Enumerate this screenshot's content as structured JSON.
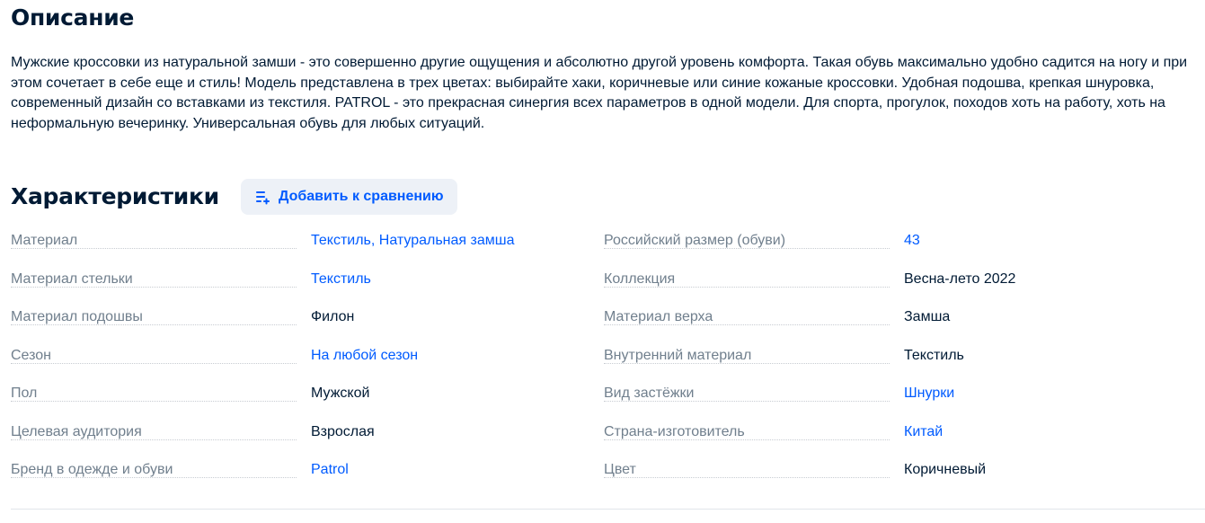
{
  "description": {
    "title": "Описание",
    "text": "Мужские кроссовки из натуральной замши - это совершенно другие ощущения и абсолютно другой уровень комфорта. Такая обувь максимально удобно садится на ногу и при этом сочетает в себе еще и стиль! Модель представлена в трех цветах: выбирайте хаки, коричневые или синие кожаные кроссовки. Удобная подошва, крепкая шнуровка, современный дизайн со вставками из текстиля. PATROL - это прекрасная синергия всех параметров в одной модели. Для спорта, прогулок, походов хоть на работу, хоть на неформальную вечеринку. Универсальная обувь для любых ситуаций."
  },
  "specs": {
    "title": "Характеристики",
    "compare_button": {
      "label": "Добавить к сравнению",
      "icon": "add-to-list-icon"
    },
    "left": [
      {
        "label": "Материал",
        "value": "Текстиль, Натуральная замша",
        "link": true
      },
      {
        "label": "Материал стельки",
        "value": "Текстиль",
        "link": true
      },
      {
        "label": "Материал подошвы",
        "value": "Филон",
        "link": false
      },
      {
        "label": "Сезон",
        "value": "На любой сезон",
        "link": true
      },
      {
        "label": "Пол",
        "value": "Мужской",
        "link": false
      },
      {
        "label": "Целевая аудитория",
        "value": "Взрослая",
        "link": false
      },
      {
        "label": "Бренд в одежде и обуви",
        "value": "Patrol",
        "link": true
      }
    ],
    "right": [
      {
        "label": "Российский размер (обуви)",
        "value": "43",
        "link": true
      },
      {
        "label": "Коллекция",
        "value": "Весна-лето 2022",
        "link": false
      },
      {
        "label": "Материал верха",
        "value": "Замша",
        "link": false
      },
      {
        "label": "Внутренний материал",
        "value": "Текстиль",
        "link": false
      },
      {
        "label": "Вид застёжки",
        "value": "Шнурки",
        "link": true
      },
      {
        "label": "Страна-изготовитель",
        "value": "Китай",
        "link": true
      },
      {
        "label": "Цвет",
        "value": "Коричневый",
        "link": false
      }
    ]
  },
  "colors": {
    "text": "#001a34",
    "muted": "#707f8d",
    "link": "#005bff",
    "button_bg": "#edf1f7"
  }
}
